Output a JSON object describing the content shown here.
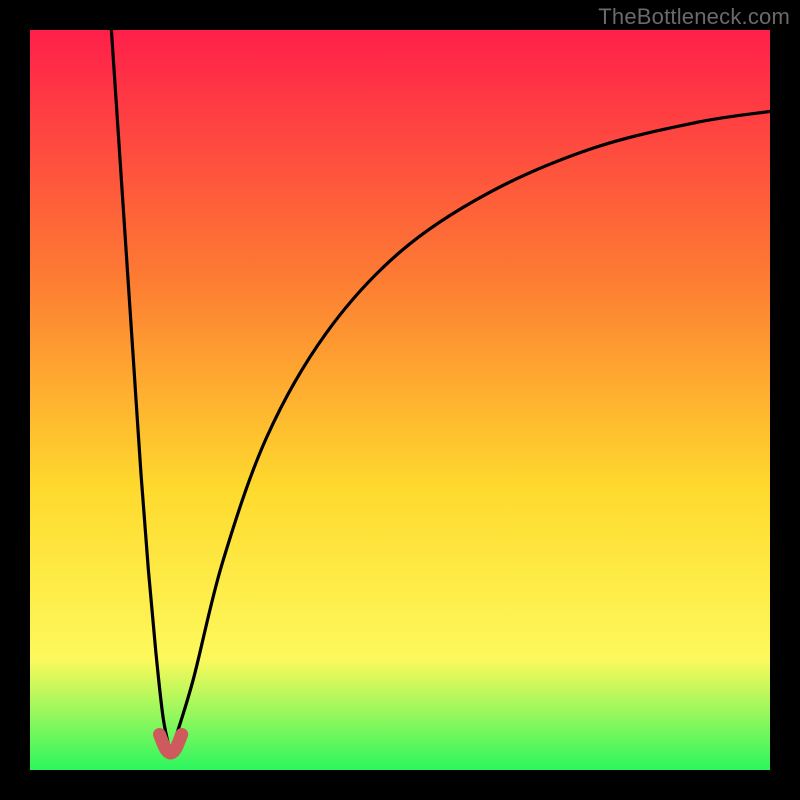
{
  "watermark": "TheBottleneck.com",
  "colors": {
    "frame": "#000000",
    "gradient_top": "#ff1f4a",
    "gradient_mid1": "#fd7a33",
    "gradient_mid2": "#feda2d",
    "gradient_mid3": "#fdf95c",
    "gradient_bottom": "#2cf65e",
    "curve": "#000000",
    "marker_fill": "#cf5a5d",
    "marker_stroke": "#cf5a5d"
  },
  "chart_data": {
    "type": "line",
    "title": "",
    "xlabel": "",
    "ylabel": "",
    "xlim": [
      0,
      100
    ],
    "ylim": [
      0,
      100
    ],
    "x_min_at": 19,
    "left_branch": {
      "x": [
        11,
        12,
        13,
        14,
        15,
        16,
        17,
        18,
        19
      ],
      "y": [
        100,
        85,
        70,
        55,
        40,
        27,
        16,
        7,
        2.3
      ]
    },
    "right_branch": {
      "x": [
        19,
        22,
        26,
        32,
        40,
        50,
        62,
        76,
        90,
        100
      ],
      "y": [
        2.3,
        12,
        28,
        45,
        59,
        70,
        78,
        84,
        87.5,
        89
      ]
    },
    "marker_points": {
      "x": [
        17.5,
        18.3,
        19.0,
        19.7,
        20.5
      ],
      "y": [
        4.8,
        2.9,
        2.3,
        2.9,
        4.8
      ]
    }
  }
}
